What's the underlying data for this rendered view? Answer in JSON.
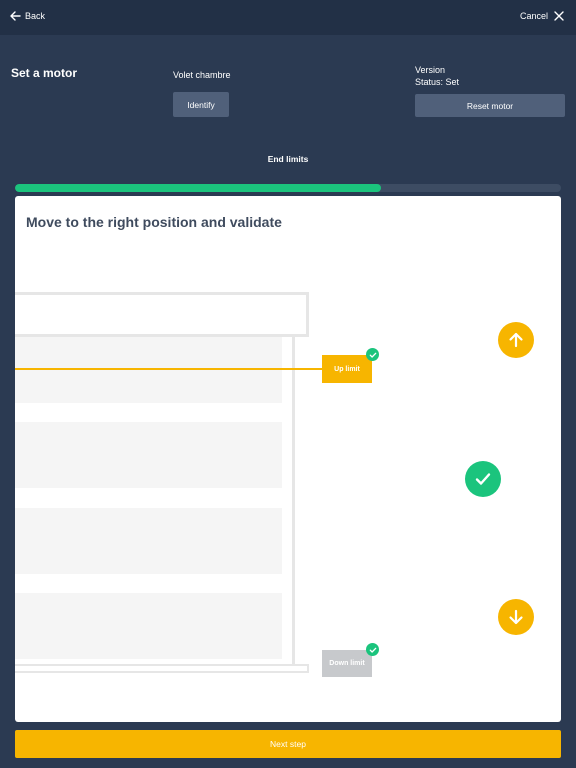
{
  "topbar": {
    "back_label": "Back",
    "cancel_label": "Cancel"
  },
  "header": {
    "title": "Set a motor",
    "motor_name": "Volet chambre",
    "identify_label": "Identify",
    "version_label": "Version",
    "status_text": "Status: Set",
    "reset_label": "Reset motor"
  },
  "step": {
    "label": "End limits",
    "progress_percent": 67
  },
  "card": {
    "heading": "Move to the right position and validate",
    "up_limit_label": "Up limit",
    "down_limit_label": "Down limit"
  },
  "controls": {
    "up_icon": "arrow-up-icon",
    "validate_icon": "check-icon",
    "down_icon": "arrow-down-icon"
  },
  "footer": {
    "next_label": "Next step"
  },
  "colors": {
    "background": "#2b3a52",
    "topbar": "#223046",
    "accent_yellow": "#f7b500",
    "accent_green": "#1bc47d",
    "button_grey": "#50607a"
  }
}
